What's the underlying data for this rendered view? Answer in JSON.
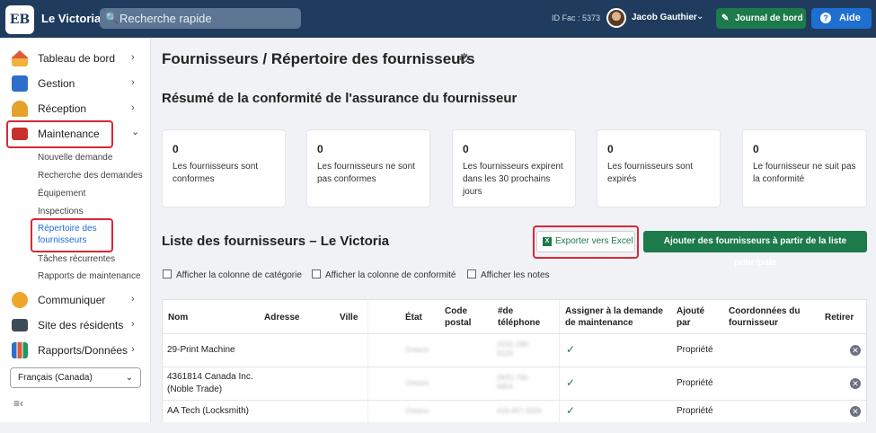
{
  "topbar": {
    "logo_text": "EB",
    "app_title": "Le Victoria",
    "search_placeholder": "Recherche rapide",
    "id_fac": "ID Fac : 5373",
    "user_name": "Jacob Gauthier",
    "journal_label": "Journal de bord",
    "help_label": "Aide"
  },
  "sidebar": {
    "items": [
      {
        "label": "Tableau de bord",
        "icon": "house-icon"
      },
      {
        "label": "Gestion",
        "icon": "building-icon"
      },
      {
        "label": "Réception",
        "icon": "bell-icon"
      },
      {
        "label": "Maintenance",
        "icon": "toolbox-icon"
      },
      {
        "label": "Communiquer",
        "icon": "chat-icon"
      },
      {
        "label": "Site des résidents",
        "icon": "monitor-icon"
      },
      {
        "label": "Rapports/Données",
        "icon": "chart-icon"
      }
    ],
    "maintenance_sub": [
      "Nouvelle demande",
      "Recherche des demandes",
      "Équipement",
      "Inspections",
      "Répertoire des",
      "fournisseurs",
      "Tâches récurrentes",
      "Rapports de maintenance"
    ],
    "language": "Français (Canada)"
  },
  "main": {
    "page_title": "Fournisseurs / Répertoire des fournisseurs",
    "summary_title": "Résumé de la conformité de l'assurance du fournisseur",
    "cards": [
      {
        "value": "0",
        "text": "Les fournisseurs sont conformes"
      },
      {
        "value": "0",
        "text": "Les fournisseurs ne sont pas conformes"
      },
      {
        "value": "0",
        "text": "Les fournisseurs expirent dans les 30 prochains jours"
      },
      {
        "value": "0",
        "text": "Les fournisseurs sont expirés"
      },
      {
        "value": "0",
        "text": "Le fournisseur ne suit pas la conformité"
      }
    ],
    "list_title": "Liste des fournisseurs – Le Victoria",
    "export_label": "Exporter vers Excel",
    "add_label": "Ajouter des fournisseurs à partir de la liste principale",
    "checkboxes": [
      "Afficher la colonne de catégorie",
      "Afficher la colonne de conformité",
      "Afficher les notes"
    ],
    "table": {
      "headers": {
        "nom": "Nom",
        "adresse": "Adresse",
        "ville": "Ville",
        "etat": "État",
        "code1": "Code",
        "code2": "postal",
        "tel1": "#de",
        "tel2": "téléphone",
        "assigner1": "Assigner à la demande",
        "assigner2": "de maintenance",
        "ajoute1": "Ajouté",
        "ajoute2": "par",
        "coord1": "Coordonnées du",
        "coord2": "fournisseur",
        "retirer": "Retirer"
      },
      "rows": [
        {
          "name1": "29-Print Machine",
          "name2": "",
          "etat": "Ontario",
          "tel1": "(416) 298-",
          "tel2": "9226",
          "ajoute": "Propriété"
        },
        {
          "name1": "4361814 Canada Inc.",
          "name2": "(Noble Trade)",
          "etat": "Ontario",
          "tel1": "(905) 760-",
          "tel2": "6804",
          "ajoute": "Propriété"
        },
        {
          "name1": "AA Tech (Locksmith)",
          "name2": "",
          "etat": "Ontario",
          "tel1": "416-457-3320",
          "tel2": "",
          "ajoute": "Propriété"
        }
      ]
    }
  }
}
